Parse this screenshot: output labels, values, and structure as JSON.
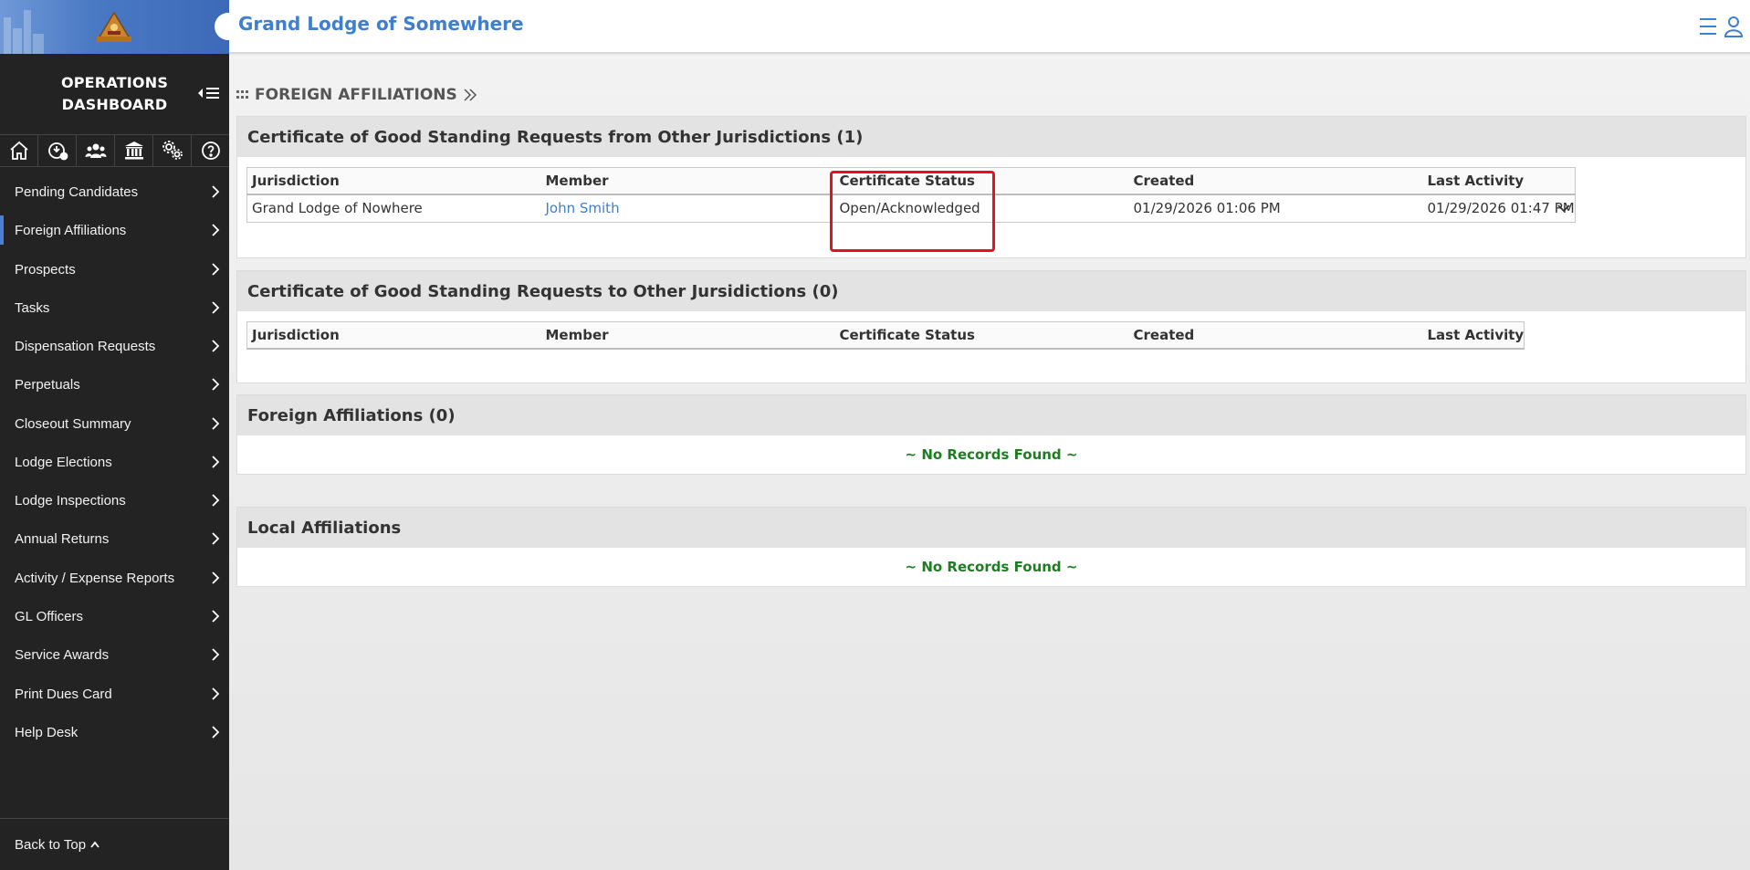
{
  "header": {
    "title": "Grand Lodge of Somewhere"
  },
  "sidebar": {
    "dashboard_title": "OPERATIONS DASHBOARD",
    "icons": [
      "home-icon",
      "download-clock-icon",
      "users-icon",
      "institution-icon",
      "gears-icon",
      "help-icon"
    ],
    "items": [
      {
        "label": "Pending Candidates"
      },
      {
        "label": "Foreign Affiliations",
        "active": true
      },
      {
        "label": "Prospects"
      },
      {
        "label": "Tasks"
      },
      {
        "label": "Dispensation Requests"
      },
      {
        "label": "Perpetuals"
      },
      {
        "label": "Closeout Summary"
      },
      {
        "label": "Lodge Elections"
      },
      {
        "label": "Lodge Inspections"
      },
      {
        "label": "Annual Returns"
      },
      {
        "label": "Activity / Expense Reports"
      },
      {
        "label": "GL Officers"
      },
      {
        "label": "Service Awards"
      },
      {
        "label": "Print Dues Card"
      },
      {
        "label": "Help Desk"
      }
    ],
    "back_to_top": "Back to Top"
  },
  "breadcrumb": {
    "label": "FOREIGN AFFILIATIONS"
  },
  "panels": {
    "from_requests": {
      "title": "Certificate of Good Standing Requests from Other Jurisdictions (1)",
      "columns": [
        "Jurisdiction",
        "Member",
        "Certificate Status",
        "Created",
        "Last Activity"
      ],
      "rows": [
        {
          "jurisdiction": "Grand Lodge of Nowhere",
          "member": "John Smith",
          "status": "Open/Acknowledged",
          "created": "01/29/2026 01:06 PM",
          "last_activity": "01/29/2026 01:47 PM"
        }
      ]
    },
    "to_requests": {
      "title": "Certificate of Good Standing Requests to Other Jursidictions (0)",
      "columns": [
        "Jurisdiction",
        "Member",
        "Certificate Status",
        "Created",
        "Last Activity"
      ]
    },
    "foreign_affiliations": {
      "title": "Foreign Affiliations (0)",
      "empty_text": "~ No Records Found ~"
    },
    "local_affiliations": {
      "title": "Local Affiliations",
      "empty_text": "~ No Records Found ~"
    }
  },
  "colors": {
    "accent": "#3f7fcf",
    "sidebar_bg": "#232323",
    "success_text": "#1e7d22",
    "highlight": "#e0141c"
  }
}
